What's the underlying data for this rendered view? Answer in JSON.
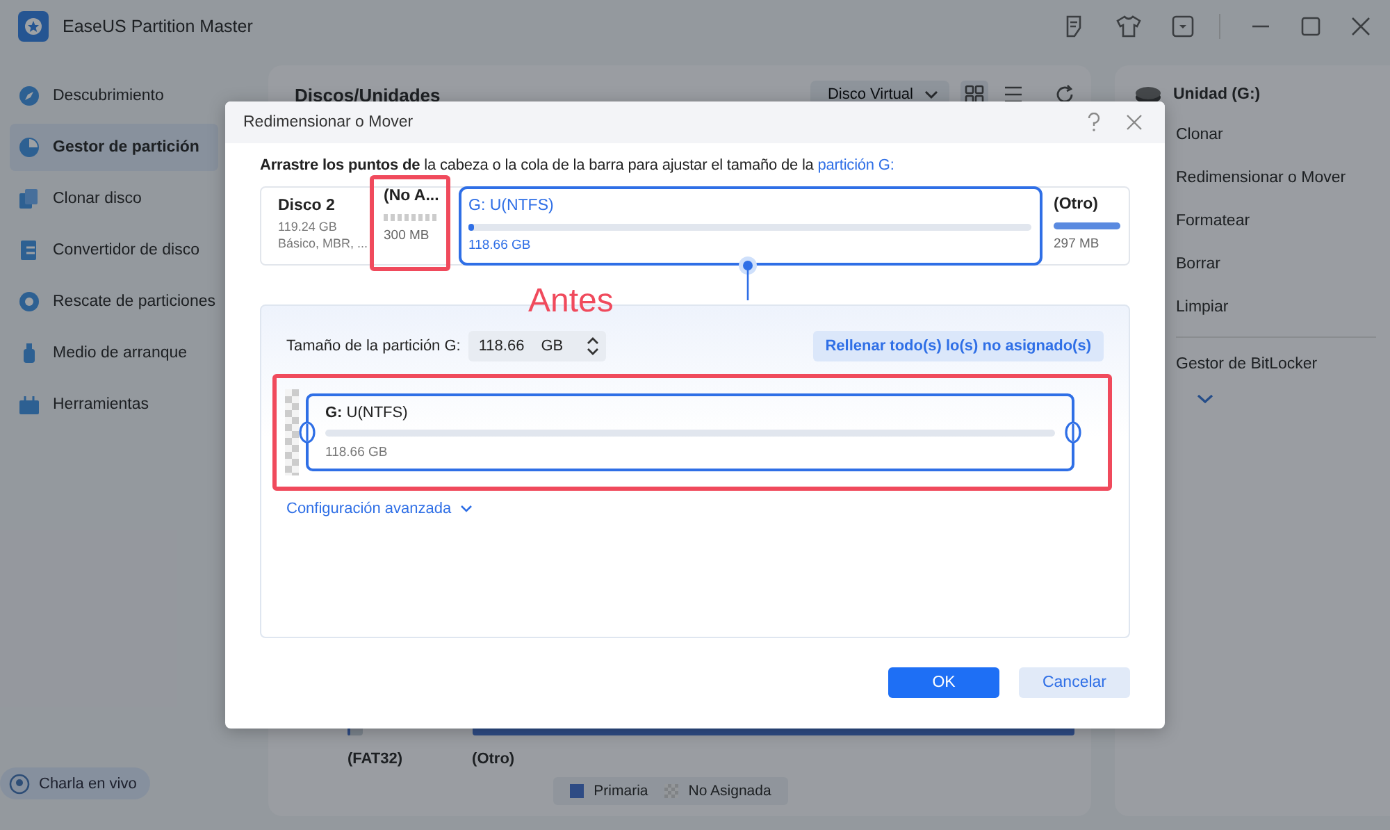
{
  "app": {
    "title": "EaseUS Partition Master"
  },
  "sidebar": {
    "items": [
      {
        "label": "Descubrimiento",
        "selected": false
      },
      {
        "label": "Gestor de partición",
        "selected": true
      },
      {
        "label": "Clonar disco",
        "selected": false
      },
      {
        "label": "Convertidor de disco",
        "selected": false
      },
      {
        "label": "Rescate de particiones",
        "selected": false
      },
      {
        "label": "Medio de arranque",
        "selected": false
      },
      {
        "label": "Herramientas",
        "selected": false
      }
    ],
    "live_chat": "Charla en vivo"
  },
  "main": {
    "title": "Discos/Unidades",
    "view_dropdown": "Disco Virtual",
    "view_toggles": [
      {
        "selected": true
      },
      {
        "selected": false
      }
    ],
    "disk_map": [
      {
        "label": "(FAT32)",
        "level": 0.15
      },
      {
        "label": "(Otro)",
        "level": 1
      }
    ],
    "legend": [
      {
        "label": "Primaria",
        "kind": "primary"
      },
      {
        "label": "No Asignada",
        "kind": "unallocated"
      }
    ]
  },
  "right_panel": {
    "drive": "Unidad (G:)",
    "actions": [
      "Clonar",
      "Redimensionar o Mover",
      "Formatear",
      "Borrar",
      "Limpiar",
      "Gestor de BitLocker"
    ],
    "expanded": false
  },
  "dialog": {
    "title": "Redimensionar o Mover",
    "instruction": "**Arrastre los puntos de** la cabeza o la cola de la barra para ajustar el tamaño de la",
    "instruction_link": "partición G:",
    "disk": {
      "name": "Disco 2",
      "size": "119.24 GB",
      "info": "Básico, MBR, ..."
    },
    "partitions": [
      {
        "kind": "unallocated",
        "label": "(No A...",
        "size": "300 MB",
        "highlighted": true
      },
      {
        "kind": "partition",
        "label": "G: U(NTFS)",
        "size": "118.66 GB",
        "level": 0.01,
        "selected": true
      },
      {
        "kind": "other",
        "label": "(Otro)",
        "size": "297 MB",
        "level": 1
      }
    ],
    "annotation": "Antes",
    "size_field": {
      "label": "Tamaño de la partición G:",
      "value": "118.66",
      "unit": "GB"
    },
    "fill_button": "Rellenar todo(s) lo(s) no asignado(s)",
    "resize_bar": {
      "drive": "G:",
      "name": "U(NTFS)",
      "size": "118.66 GB",
      "highlighted": true
    },
    "advanced": {
      "label": "Configuración avanzada",
      "expanded": false
    },
    "buttons": [
      {
        "label": "OK",
        "kind": "primary"
      },
      {
        "label": "Cancelar",
        "kind": "secondary"
      }
    ]
  }
}
